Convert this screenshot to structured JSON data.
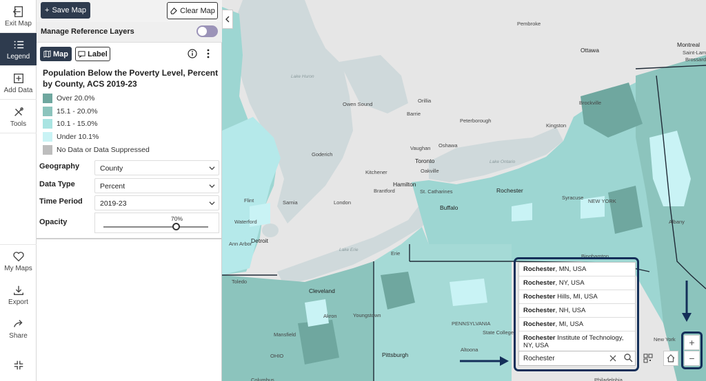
{
  "rail": {
    "exit": "Exit Map",
    "legend": "Legend",
    "add_data": "Add Data",
    "tools": "Tools",
    "my_maps": "My Maps",
    "export": "Export",
    "share": "Share"
  },
  "panel": {
    "save_label": "Save Map",
    "clear_label": "Clear Map",
    "reference_layers": "Manage Reference Layers",
    "tab_map": "Map",
    "tab_label": "Label",
    "legend_title": "Population Below the Poverty Level, Percent by County, ACS 2019-23",
    "legend_items": [
      {
        "label": "Over 20.0%",
        "color": "#6fa79f"
      },
      {
        "label": "15.1 - 20.0%",
        "color": "#8cc4bd"
      },
      {
        "label": "10.1 - 15.0%",
        "color": "#a9e4e2"
      },
      {
        "label": "Under 10.1%",
        "color": "#c9f3f5"
      },
      {
        "label": "No Data or Data Suppressed",
        "color": "#bdbdbd"
      }
    ],
    "geography_label": "Geography",
    "geography_value": "County",
    "data_type_label": "Data Type",
    "data_type_value": "Percent",
    "time_period_label": "Time Period",
    "time_period_value": "2019-23",
    "opacity_label": "Opacity",
    "opacity_value": "70%",
    "opacity_fraction": 0.7
  },
  "map": {
    "places": [
      {
        "name": "Pembroke",
        "cls": ""
      },
      {
        "name": "Ottawa",
        "cls": "big"
      },
      {
        "name": "Montreal",
        "cls": "big"
      },
      {
        "name": "Saint-Lambert",
        "cls": ""
      },
      {
        "name": "Brossard",
        "cls": ""
      },
      {
        "name": "Lake Huron",
        "cls": "lake"
      },
      {
        "name": "Owen Sound",
        "cls": ""
      },
      {
        "name": "Orillia",
        "cls": ""
      },
      {
        "name": "Barrie",
        "cls": ""
      },
      {
        "name": "Peterborough",
        "cls": ""
      },
      {
        "name": "Brockville",
        "cls": ""
      },
      {
        "name": "Kingston",
        "cls": ""
      },
      {
        "name": "Goderich",
        "cls": ""
      },
      {
        "name": "Oshawa",
        "cls": ""
      },
      {
        "name": "Vaughan",
        "cls": ""
      },
      {
        "name": "Toronto",
        "cls": "big"
      },
      {
        "name": "Kitchener",
        "cls": ""
      },
      {
        "name": "Oakville",
        "cls": ""
      },
      {
        "name": "Lake Ontario",
        "cls": "lake"
      },
      {
        "name": "Brantford",
        "cls": ""
      },
      {
        "name": "Hamilton",
        "cls": "big"
      },
      {
        "name": "St. Catharines",
        "cls": ""
      },
      {
        "name": "Rochester",
        "cls": "big"
      },
      {
        "name": "Syracuse",
        "cls": ""
      },
      {
        "name": "NEW YORK",
        "cls": ""
      },
      {
        "name": "Flint",
        "cls": ""
      },
      {
        "name": "Sarnia",
        "cls": ""
      },
      {
        "name": "London",
        "cls": ""
      },
      {
        "name": "Buffalo",
        "cls": "big"
      },
      {
        "name": "Albany",
        "cls": ""
      },
      {
        "name": "Waterford",
        "cls": ""
      },
      {
        "name": "Detroit",
        "cls": "big"
      },
      {
        "name": "Ann Arbor",
        "cls": ""
      },
      {
        "name": "Lake Erie",
        "cls": "lake"
      },
      {
        "name": "Erie",
        "cls": ""
      },
      {
        "name": "Binghamton",
        "cls": ""
      },
      {
        "name": "Toledo",
        "cls": ""
      },
      {
        "name": "Cleveland",
        "cls": "big"
      },
      {
        "name": "Akron",
        "cls": ""
      },
      {
        "name": "Youngstown",
        "cls": ""
      },
      {
        "name": "PENNSYLVANIA",
        "cls": ""
      },
      {
        "name": "State College",
        "cls": ""
      },
      {
        "name": "Mansfield",
        "cls": ""
      },
      {
        "name": "OHIO",
        "cls": ""
      },
      {
        "name": "Pittsburgh",
        "cls": "big"
      },
      {
        "name": "Altoona",
        "cls": ""
      },
      {
        "name": "Columbus",
        "cls": ""
      },
      {
        "name": "New York",
        "cls": ""
      },
      {
        "name": "Philadelphia",
        "cls": ""
      }
    ]
  },
  "search": {
    "query": "Rochester",
    "suggestions": [
      {
        "bold": "Rochester",
        "rest": ", MN, USA"
      },
      {
        "bold": "Rochester",
        "rest": ", NY, USA"
      },
      {
        "bold": "Rochester",
        "rest": " Hills, MI, USA"
      },
      {
        "bold": "Rochester",
        "rest": ", NH, USA"
      },
      {
        "bold": "Rochester",
        "rest": ", MI, USA"
      },
      {
        "bold": "Rochester",
        "rest": " Institute of Technology, NY, USA"
      }
    ]
  },
  "zoom": {
    "in": "+",
    "out": "−"
  }
}
